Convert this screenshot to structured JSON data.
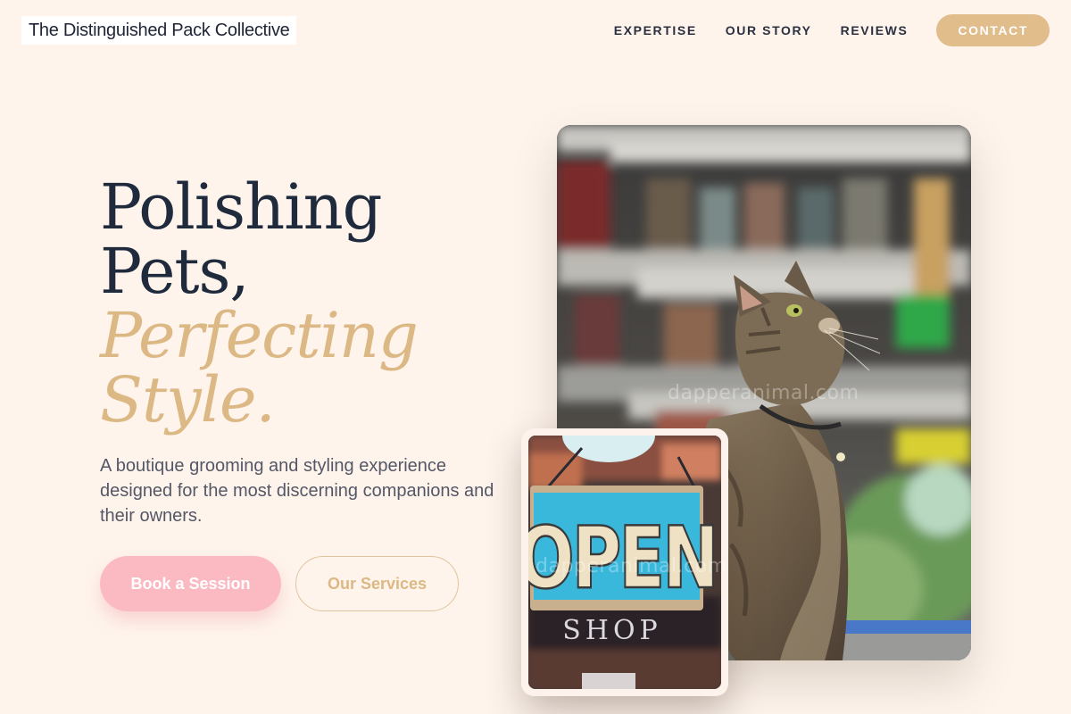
{
  "brand": {
    "name": "The Distinguished Pack Collective"
  },
  "nav": {
    "links": [
      "EXPERTISE",
      "OUR STORY",
      "REVIEWS"
    ],
    "contact_label": "CONTACT"
  },
  "hero": {
    "headline_line1": "Polishing",
    "headline_line2": "Pets,",
    "headline_accent_line1": "Perfecting",
    "headline_accent_line2": "Style.",
    "subtext": "A boutique grooming and styling experience designed for the most discerning companions and their owners.",
    "primary_cta": "Book a Session",
    "secondary_cta": "Our Services"
  },
  "images": {
    "main_watermark": "dapperanimal.com",
    "inset_watermark": "dapperanimal.com",
    "sign_word": "OPEN",
    "sign_subword": "SHOP"
  },
  "colors": {
    "background": "#fef4ec",
    "accent_gold": "#dcb885",
    "accent_pink": "#fbbac2",
    "text_dark": "#1f2a3c"
  }
}
